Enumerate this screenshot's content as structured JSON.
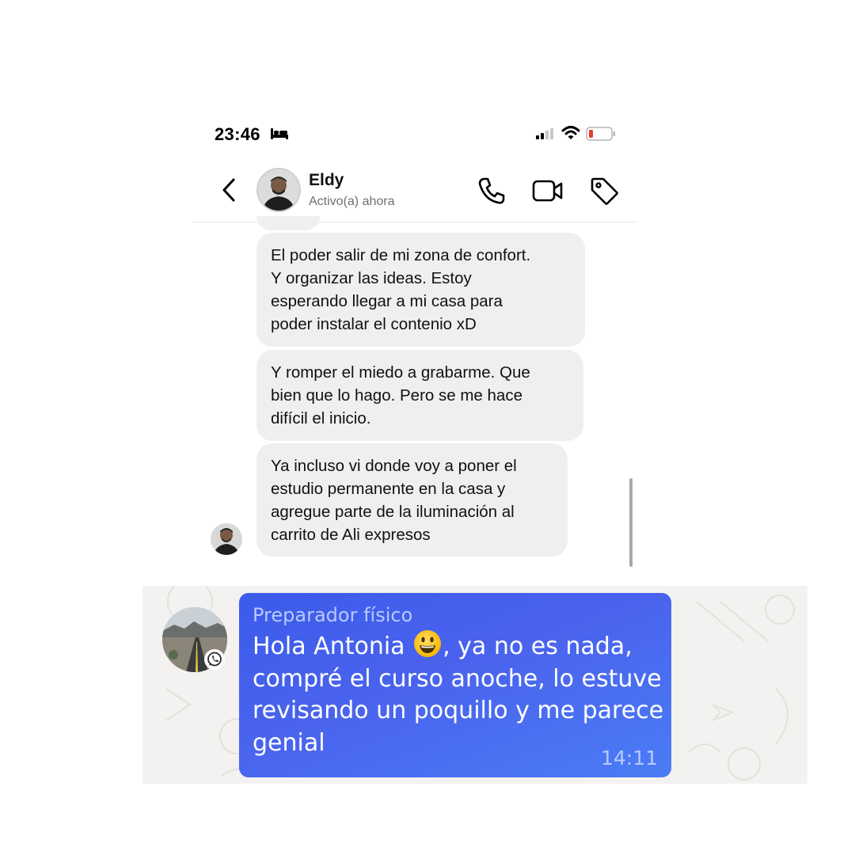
{
  "status_bar": {
    "time": "23:46",
    "icons": [
      "bed-icon",
      "signal-icon",
      "wifi-icon",
      "battery-icon"
    ]
  },
  "chat_header": {
    "contact_name": "Eldy",
    "contact_status": "Activo(a) ahora",
    "icons": [
      "back-icon",
      "avatar",
      "call-icon",
      "video-call-icon",
      "tag-icon"
    ]
  },
  "messages": [
    {
      "text": "El poder salir de mi zona de confort.\nY organizar las ideas. Estoy\nesperando llegar a mi casa para\npoder instalar el contenio xD"
    },
    {
      "text": "Y romper el miedo a grabarme. Que\nbien que lo hago. Pero se me hace\ndifícil el inicio."
    },
    {
      "text": "Ya incluso vi donde voy a poner el\nestudio permanente en la casa y\nagregue parte de la iluminación al\ncarrito de Ali expresos"
    }
  ],
  "whatsapp": {
    "sender": "Preparador físico",
    "text_before_emoji": "Hola Antonia ",
    "emoji": "smiling-face-emoji",
    "text_after_emoji": ", ya no es nada,\ncompré el curso anoche, lo estuve\nrevisando un poquillo y me parece\ngenial",
    "time": "14:11"
  },
  "colors": {
    "incoming_bubble": "#efefef",
    "whatsapp_bubble": "#4a63ee",
    "whatsapp_background": "#f3f2f0",
    "battery_low": "#e8382f"
  }
}
